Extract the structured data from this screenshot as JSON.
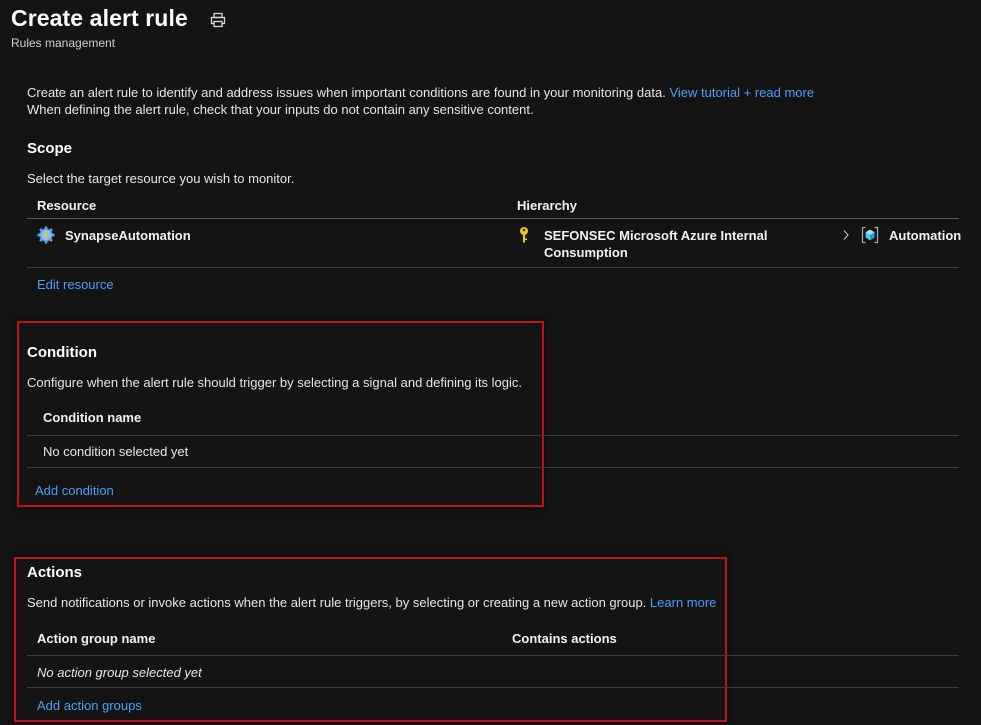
{
  "header": {
    "title": "Create alert rule",
    "subtitle": "Rules management",
    "print_icon": "print-icon"
  },
  "intro": {
    "text": "Create an alert rule to identify and address issues when important conditions are found in your monitoring data.",
    "tutorial_link": "View tutorial + read more",
    "note": "When defining the alert rule, check that your inputs do not contain any sensitive content."
  },
  "scope": {
    "heading": "Scope",
    "description": "Select the target resource you wish to monitor.",
    "columns": {
      "resource": "Resource",
      "hierarchy": "Hierarchy"
    },
    "row": {
      "resource_name": "SynapseAutomation",
      "resource_icon": "automation-gear-icon",
      "hierarchy_line1": "SEFONSEC Microsoft Azure Internal",
      "hierarchy_line2": "Consumption",
      "hierarchy_icon": "key-icon",
      "hierarchy_next": "Automation",
      "hierarchy_next_icon": "cube-icon"
    },
    "edit_link": "Edit resource"
  },
  "condition": {
    "heading": "Condition",
    "description": "Configure when the alert rule should trigger by selecting a signal and defining its logic.",
    "column": "Condition name",
    "empty_text": "No condition selected yet",
    "add_link": "Add condition"
  },
  "actions": {
    "heading": "Actions",
    "description": "Send notifications or invoke actions when the alert rule triggers, by selecting or creating a new action group.",
    "learn_more": "Learn more",
    "columns": {
      "name": "Action group name",
      "contains": "Contains actions"
    },
    "empty_text": "No action group selected yet",
    "add_link": "Add action groups"
  },
  "colors": {
    "background": "#141414",
    "link": "#4f9ef8",
    "highlight_box": "#c50f1f",
    "key": "#f2c811"
  }
}
